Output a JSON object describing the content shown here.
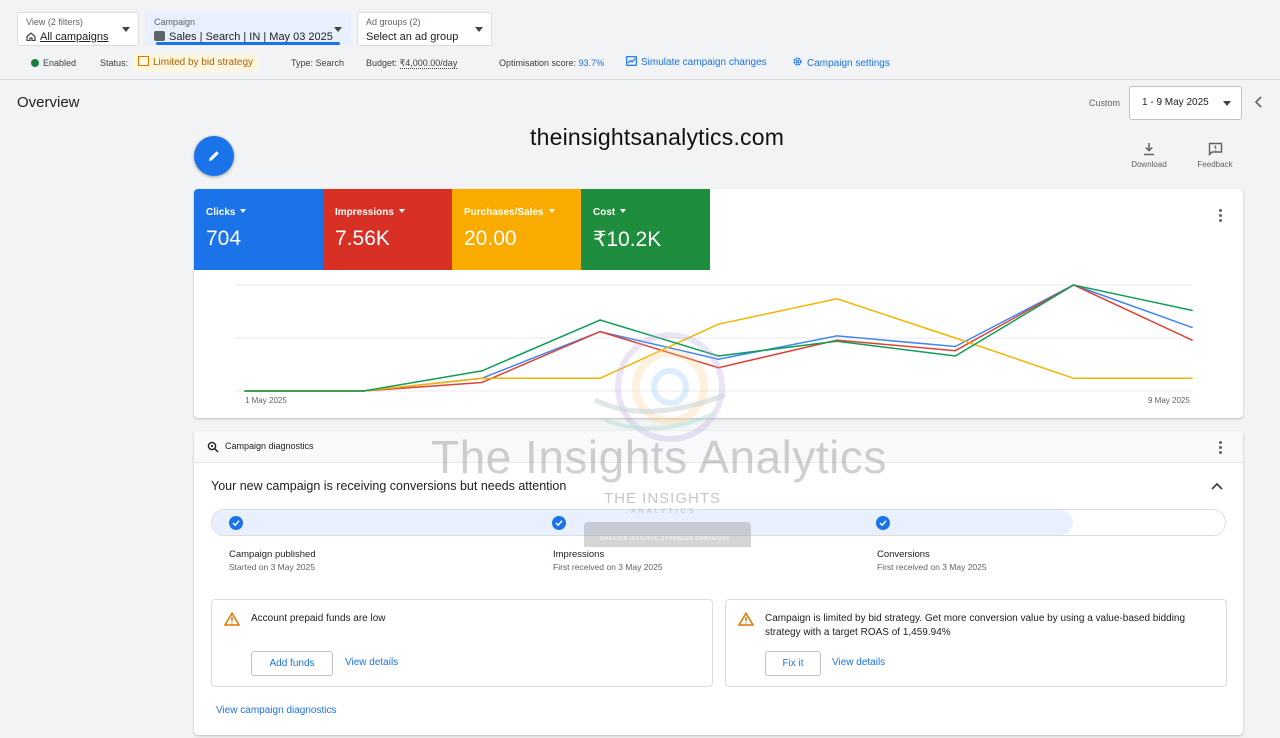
{
  "filters": {
    "view": {
      "label": "View (2 filters)",
      "value": "All campaigns"
    },
    "campaign": {
      "label": "Campaign",
      "value": "Sales | Search | IN | May 03 2025"
    },
    "ad_groups": {
      "label": "Ad groups (2)",
      "value": "Select an ad group"
    }
  },
  "status_row": {
    "enabled": "Enabled",
    "status_label": "Status:",
    "status_value": "Limited by bid strategy",
    "type": "Type: Search",
    "budget_label": "Budget:",
    "budget_value": "₹4,000.00/day",
    "opt_label": "Optimisation score:",
    "opt_value": "93.7%",
    "simulate": "Simulate campaign changes",
    "settings": "Campaign settings"
  },
  "overview": {
    "title": "Overview",
    "custom_label": "Custom",
    "date_range": "1 - 9 May 2025",
    "download": "Download",
    "feedback": "Feedback"
  },
  "watermark": {
    "url": "theinsightsanalytics.com",
    "text": "The Insights Analytics",
    "brand": "THE INSIGHTS",
    "brand_sub": "ANALYTICS",
    "tagline": "SMARTER INSIGHTS. STRONGER CAMPAIGNS"
  },
  "metrics": [
    {
      "name": "Clicks",
      "value": "704",
      "color": "#1a73e8"
    },
    {
      "name": "Impressions",
      "value": "7.56K",
      "color": "#d93025"
    },
    {
      "name": "Purchases/Sales",
      "value": "20.00",
      "color": "#f9ab00"
    },
    {
      "name": "Cost",
      "value": "₹10.2K",
      "color": "#1e8e3e"
    }
  ],
  "chart_data": {
    "type": "line",
    "x": [
      "1 May 2025",
      "2 May 2025",
      "3 May 2025",
      "4 May 2025",
      "5 May 2025",
      "6 May 2025",
      "7 May 2025",
      "8 May 2025",
      "9 May 2025"
    ],
    "x_tick_labels": [
      "1 May 2025",
      "9 May 2025"
    ],
    "grid": true,
    "normalized": true,
    "ylim": [
      0,
      1
    ],
    "series": [
      {
        "name": "Clicks",
        "color": "#4285f4",
        "values": [
          0,
          0,
          0.12,
          0.56,
          0.3,
          0.52,
          0.42,
          1.0,
          0.6
        ]
      },
      {
        "name": "Impressions",
        "color": "#db4437",
        "values": [
          0,
          0,
          0.08,
          0.56,
          0.22,
          0.48,
          0.38,
          1.0,
          0.48
        ]
      },
      {
        "name": "Purchases/Sales",
        "color": "#f4b400",
        "values": [
          0,
          0,
          0.12,
          0.12,
          0.63,
          0.87,
          0.5,
          0.12,
          0.12
        ]
      },
      {
        "name": "Cost",
        "color": "#0f9d58",
        "values": [
          0,
          0,
          0.19,
          0.67,
          0.33,
          0.47,
          0.33,
          1.0,
          0.76
        ]
      }
    ]
  },
  "diagnostics": {
    "title": "Campaign diagnostics",
    "headline": "Your new campaign is receiving conversions but needs attention",
    "steps": [
      {
        "name": "Campaign published",
        "date": "Started on 3 May 2025"
      },
      {
        "name": "Impressions",
        "date": "First received on 3 May 2025"
      },
      {
        "name": "Conversions",
        "date": "First received on 3 May 2025"
      }
    ],
    "progress": 0.85,
    "alerts": [
      {
        "text": "Account prepaid funds are low",
        "action": "Add funds",
        "details": "View details"
      },
      {
        "text": "Campaign is limited by bid strategy. Get more conversion value by using a value-based bidding strategy with a target ROAS of 1,459.94%",
        "action": "Fix it",
        "details": "View details"
      }
    ],
    "view_link": "View campaign diagnostics"
  }
}
